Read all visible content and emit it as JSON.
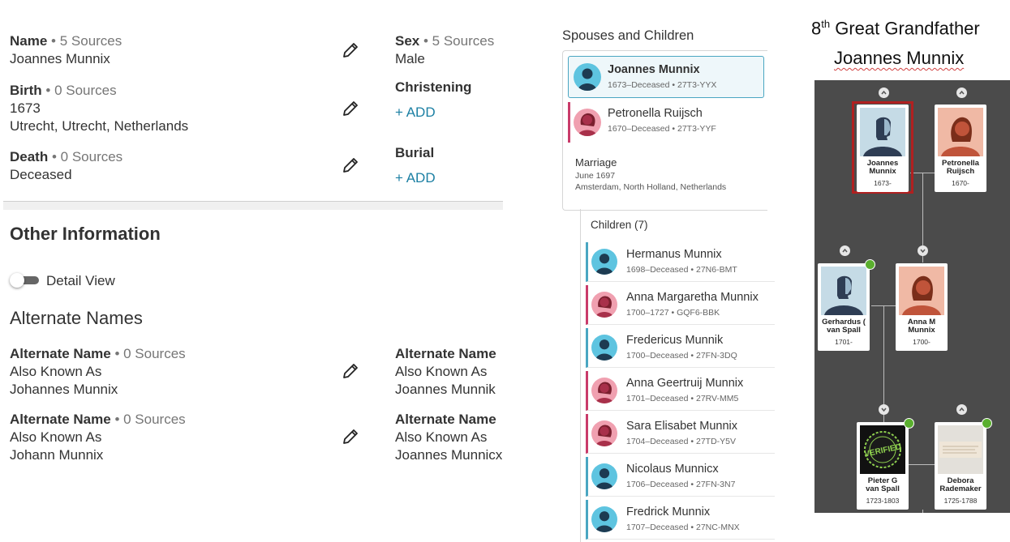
{
  "vitals": {
    "name": {
      "label": "Name",
      "sources": "• 5 Sources",
      "value": "Joannes Munnix"
    },
    "sex": {
      "label": "Sex",
      "sources": "• 5 Sources",
      "value": "Male"
    },
    "birth": {
      "label": "Birth",
      "sources": "• 0 Sources",
      "date": "1673",
      "place": "Utrecht, Utrecht, Netherlands"
    },
    "christening": {
      "label": "Christening",
      "add": "+  ADD"
    },
    "death": {
      "label": "Death",
      "sources": "• 0 Sources",
      "value": "Deceased"
    },
    "burial": {
      "label": "Burial",
      "add": "+  ADD"
    }
  },
  "other": {
    "heading": "Other Information",
    "detail_view": "Detail View",
    "alt_heading": "Alternate Names",
    "alt_names": [
      {
        "label": "Alternate Name",
        "sources": "• 0 Sources",
        "type": "Also Known As",
        "value": "Johannes Munnix"
      },
      {
        "label": "Alternate Name",
        "type": "Also Known As",
        "value": "Joannes Munnik"
      },
      {
        "label": "Alternate Name",
        "sources": "• 0 Sources",
        "type": "Also Known As",
        "value": "Johann Munnix"
      },
      {
        "label": "Alternate Name",
        "type": "Also Known As",
        "value": "Joannes Munnicx"
      }
    ]
  },
  "family": {
    "heading": "Spouses and Children",
    "husband": {
      "name": "Joannes Munnix",
      "meta": "1673–Deceased • 27T3-YYX"
    },
    "wife": {
      "name": "Petronella Ruijsch",
      "meta": "1670–Deceased • 27T3-YYF"
    },
    "marriage": {
      "label": "Marriage",
      "date": "June 1697",
      "place": "Amsterdam, North Holland, Netherlands"
    },
    "children_label": "Children (7)",
    "children": [
      {
        "name": "Hermanus Munnix",
        "meta": "1698–Deceased • 27N6-BMT",
        "sex": "male"
      },
      {
        "name": "Anna Margaretha Munnix",
        "meta": "1700–1727 • GQF6-BBK",
        "sex": "female"
      },
      {
        "name": "Fredericus Munnik",
        "meta": "1700–Deceased • 27FN-3DQ",
        "sex": "male"
      },
      {
        "name": "Anna Geertruij Munnix",
        "meta": "1701–Deceased • 27RV-MM5",
        "sex": "female"
      },
      {
        "name": "Sara Elisabet Munnix",
        "meta": "1704–Deceased • 27TD-Y5V",
        "sex": "female"
      },
      {
        "name": "Nicolaus Munnicx",
        "meta": "1706–Deceased • 27FN-3N7",
        "sex": "male"
      },
      {
        "name": "Fredrick Munnix",
        "meta": "1707–Deceased • 27NC-MNX",
        "sex": "male"
      }
    ]
  },
  "caption": {
    "ordinal": "8",
    "sup": "th",
    "line1_rest": " Great Grandfather",
    "line2": "Joannes Munnix"
  },
  "tree": {
    "joannes": {
      "name1": "Joannes",
      "name2": "Munnix",
      "dates": "1673-"
    },
    "petronella": {
      "name1": "Petronella",
      "name2": "Ruijsch",
      "dates": "1670-"
    },
    "gerhardus": {
      "name1": "Gerhardus (",
      "name2": "van Spall",
      "dates": "1701-"
    },
    "anna": {
      "name1": "Anna M",
      "name2": "Munnix",
      "dates": "1700-"
    },
    "pieter": {
      "name1": "Pieter G",
      "name2": "van Spall",
      "dates": "1723-1803",
      "badge": "VERIFIED"
    },
    "debora": {
      "name1": "Debora",
      "name2": "Rademaker",
      "dates": "1725-1788"
    }
  },
  "colors": {
    "link": "#1b7fa3",
    "male": "#4aa6c2",
    "female": "#c93b6a",
    "tree_bg": "#4b4b4b",
    "highlight": "#b02020"
  }
}
